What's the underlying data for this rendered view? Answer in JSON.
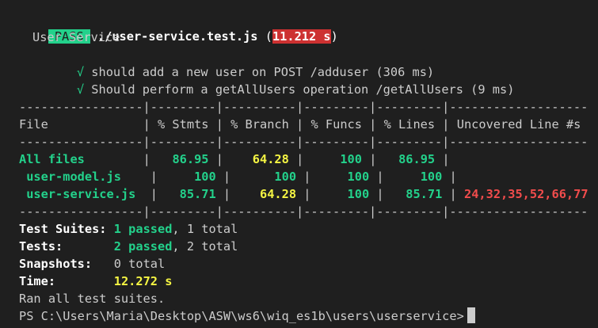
{
  "header": {
    "pass_label": "PASS",
    "test_file": "./user-service.test.js",
    "paren_open": "(",
    "duration": "11.212 s",
    "paren_close": ")"
  },
  "suite": {
    "name": "User Service",
    "tests": [
      {
        "check": "√",
        "text": "should add a new user on POST /adduser (306 ms)"
      },
      {
        "check": "√",
        "text": "Should perform a getAllUsers operation /getAllUsers (9 ms)"
      }
    ]
  },
  "coverage": {
    "separator": "-----------------|---------|----------|---------|---------|-------------------",
    "pipe": "|",
    "headers": [
      "File",
      "% Stmts",
      "% Branch",
      "% Funcs",
      "% Lines",
      "Uncovered Line #s"
    ],
    "rows": [
      {
        "file": "All files",
        "stmts": "86.95",
        "branch": "64.28",
        "funcs": "100",
        "lines": "86.95",
        "uncovered": ""
      },
      {
        "file": " user-model.js",
        "stmts": "100",
        "branch": "100",
        "funcs": "100",
        "lines": "100",
        "uncovered": ""
      },
      {
        "file": " user-service.js",
        "stmts": "85.71",
        "branch": "64.28",
        "funcs": "100",
        "lines": "85.71",
        "uncovered": "24,32,35,52,66,77"
      }
    ]
  },
  "summary": {
    "suites_label": "Test Suites:",
    "suites_passed": "1 passed",
    "suites_total": ", 1 total",
    "tests_label": "Tests:",
    "tests_passed": "2 passed",
    "tests_total": ", 2 total",
    "snapshots_label": "Snapshots:",
    "snapshots_value": "0 total",
    "time_label": "Time:",
    "time_value": "12.272 s",
    "ran_all": "Ran all test suites."
  },
  "prompt": {
    "text": "PS C:\\Users\\Maria\\Desktop\\ASW\\ws6\\wiq_es1b\\users\\userservice>"
  },
  "colors": {
    "background": "#1f1f1f",
    "foreground": "#cccccc",
    "pass_green": "#23d18b",
    "warn_yellow": "#f5f543",
    "error_red": "#f14c4c",
    "time_badge_red": "#cd3131"
  }
}
